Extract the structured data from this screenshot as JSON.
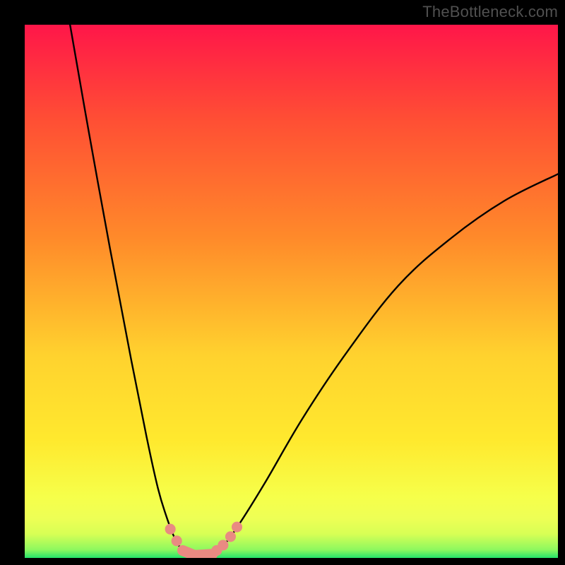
{
  "watermark": "TheBottleneck.com",
  "colors": {
    "background_black": "#000000",
    "gradient_top": "#ff1649",
    "gradient_mid_upper": "#ff8a2a",
    "gradient_mid": "#ffe92e",
    "gradient_low": "#f6ff4a",
    "gradient_band": "#d8ff55",
    "gradient_bottom": "#24e26a",
    "curve": "#000000",
    "marker_fill": "#e98a82",
    "marker_stroke": "#d46a62"
  },
  "chart_data": {
    "type": "line",
    "title": "",
    "xlabel": "",
    "ylabel": "",
    "xlim": [
      0,
      100
    ],
    "ylim": [
      0,
      100
    ],
    "curve_left": [
      {
        "x": 8.5,
        "y": 100
      },
      {
        "x": 12,
        "y": 80
      },
      {
        "x": 16,
        "y": 58
      },
      {
        "x": 20,
        "y": 37
      },
      {
        "x": 23,
        "y": 22
      },
      {
        "x": 25,
        "y": 13
      },
      {
        "x": 26.5,
        "y": 8
      },
      {
        "x": 28,
        "y": 4
      },
      {
        "x": 29.5,
        "y": 1.5
      },
      {
        "x": 31,
        "y": 0.6
      }
    ],
    "curve_right": [
      {
        "x": 35,
        "y": 0.6
      },
      {
        "x": 37,
        "y": 2
      },
      {
        "x": 40,
        "y": 6
      },
      {
        "x": 45,
        "y": 14
      },
      {
        "x": 52,
        "y": 26
      },
      {
        "x": 60,
        "y": 38
      },
      {
        "x": 70,
        "y": 51
      },
      {
        "x": 80,
        "y": 60
      },
      {
        "x": 90,
        "y": 67
      },
      {
        "x": 100,
        "y": 72
      }
    ],
    "markers_round": [
      {
        "x": 27.3,
        "y": 5.4,
        "r": 1.0
      },
      {
        "x": 28.5,
        "y": 3.2,
        "r": 1.0
      },
      {
        "x": 36.0,
        "y": 1.4,
        "r": 1.0
      },
      {
        "x": 37.2,
        "y": 2.4,
        "r": 1.0
      },
      {
        "x": 38.6,
        "y": 4.0,
        "r": 1.0
      },
      {
        "x": 39.8,
        "y": 5.8,
        "r": 1.0
      }
    ],
    "markers_capsule": [
      {
        "x1": 29.6,
        "y1": 1.4,
        "x2": 31.6,
        "y2": 0.6,
        "w": 2.0
      },
      {
        "x1": 32.0,
        "y1": 0.5,
        "x2": 35.2,
        "y2": 0.7,
        "w": 2.0
      }
    ]
  }
}
